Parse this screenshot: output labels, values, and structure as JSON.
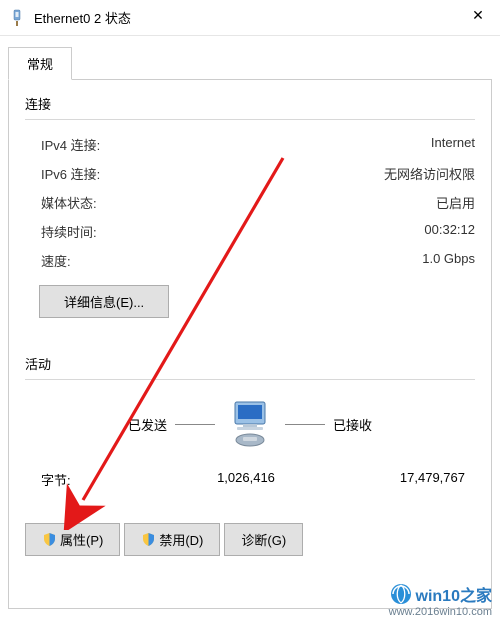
{
  "window": {
    "title": "Ethernet0 2 状态",
    "close_glyph": "✕"
  },
  "tabs": {
    "general": "常规"
  },
  "connection": {
    "section": "连接",
    "ipv4_label": "IPv4 连接:",
    "ipv4_value": "Internet",
    "ipv6_label": "IPv6 连接:",
    "ipv6_value": "无网络访问权限",
    "media_label": "媒体状态:",
    "media_value": "已启用",
    "duration_label": "持续时间:",
    "duration_value": "00:32:12",
    "speed_label": "速度:",
    "speed_value": "1.0 Gbps",
    "details_button": "详细信息(E)..."
  },
  "activity": {
    "section": "活动",
    "sent_label": "已发送",
    "received_label": "已接收",
    "bytes_label": "字节:",
    "bytes_sent": "1,026,416",
    "bytes_received": "17,479,767"
  },
  "buttons": {
    "properties": "属性(P)",
    "disable": "禁用(D)",
    "diagnose": "诊断(G)"
  },
  "watermark": {
    "text_bold": "win10",
    "text_rest": "之家",
    "url": "www.2016win10.com"
  }
}
